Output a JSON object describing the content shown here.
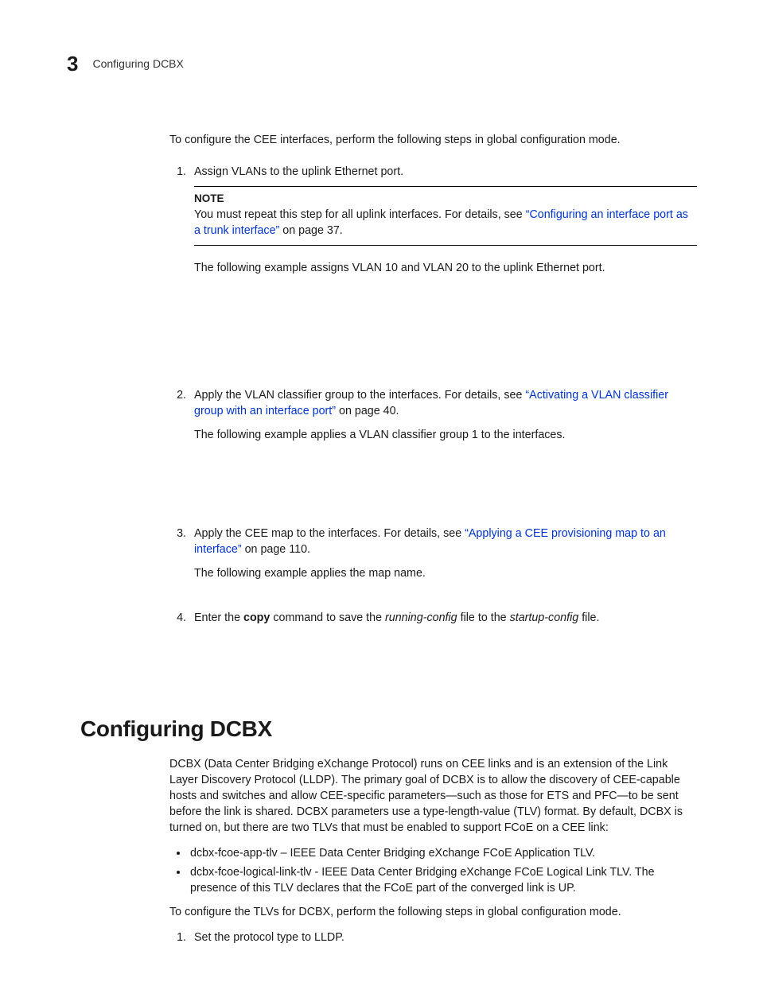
{
  "header": {
    "chapter": "3",
    "title": "Configuring DCBX"
  },
  "intro": "To configure the CEE interfaces, perform the following steps in global configuration mode.",
  "step1": {
    "num": "1.",
    "text": "Assign VLANs to the uplink Ethernet port.",
    "note_label": "NOTE",
    "note_pre": "You must repeat this step for all uplink interfaces. For details, see ",
    "note_link": "“Configuring an interface port as a trunk interface”",
    "note_post": " on page 37.",
    "example": "The following example assigns VLAN 10 and VLAN 20 to the uplink Ethernet port."
  },
  "step2": {
    "num": "2.",
    "pre": "Apply the VLAN classifier group to the interfaces. For details, see ",
    "link": "“Activating a VLAN classifier group with an interface port”",
    "post": " on page 40.",
    "example": "The following example applies a VLAN classifier group 1 to the interfaces."
  },
  "step3": {
    "num": "3.",
    "pre": "Apply the CEE map to the interfaces. For details, see ",
    "link": "“Applying a CEE provisioning map to an interface”",
    "post": " on page 110.",
    "example": "The following example applies the map name."
  },
  "step4": {
    "num": "4.",
    "t1": "Enter the ",
    "cmd": "copy",
    "t2": " command to save the ",
    "it1": "running-config",
    "t3": " file to the ",
    "it2": "startup-config",
    "t4": " file."
  },
  "section2": {
    "heading": "Configuring DCBX",
    "p1": "DCBX (Data Center Bridging eXchange Protocol) runs on CEE links and is an extension of the Link Layer Discovery Protocol (LLDP). The primary goal of DCBX is to allow the discovery of CEE-capable hosts and switches and allow CEE-specific parameters—such as those for ETS and PFC—to be sent before the link is shared. DCBX parameters use a type-length-value (TLV) format. By default, DCBX is turned on, but there are two TLVs that must be enabled to support FCoE on a CEE link:",
    "b1": "dcbx-fcoe-app-tlv – IEEE Data Center Bridging eXchange FCoE Application TLV.",
    "b2": "dcbx-fcoe-logical-link-tlv - IEEE Data Center Bridging eXchange FCoE Logical Link TLV. The presence of this TLV declares that the FCoE part of the converged link is UP.",
    "p2": "To configure the TLVs for DCBX, perform the following steps in global configuration mode.",
    "s1num": "1.",
    "s1": "Set the protocol type to LLDP."
  }
}
